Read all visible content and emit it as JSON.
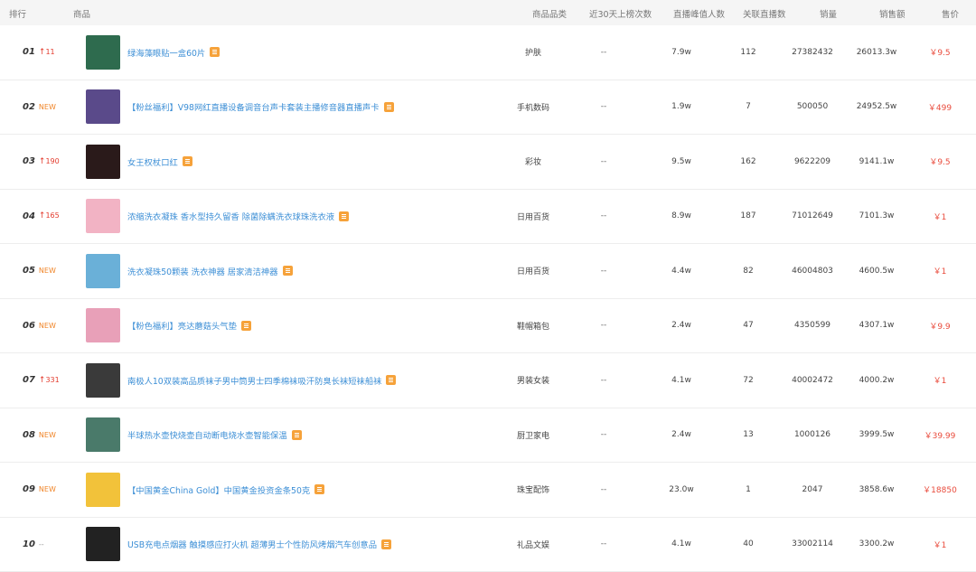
{
  "headers": {
    "rank": "排行",
    "product": "商品",
    "category": "商品品类",
    "times": "近30天上榜次数",
    "peak": "直播峰值人数",
    "live": "关联直播数",
    "sales": "销量",
    "amount": "销售额",
    "price": "售价"
  },
  "rows": [
    {
      "rank": "01",
      "change": "11",
      "change_type": "up",
      "name": "绿海藻眼贴一盒60片",
      "category": "护肤",
      "times": "--",
      "peak": "7.9w",
      "live": "112",
      "sales": "27382432",
      "amount": "26013.3w",
      "price": "￥9.5",
      "thumb_color": "#2e6b4e"
    },
    {
      "rank": "02",
      "change": "NEW",
      "change_type": "new",
      "name": "【粉丝福利】V98网红直播设备调音台声卡套装主播修音器直播声卡",
      "category": "手机数码",
      "times": "--",
      "peak": "1.9w",
      "live": "7",
      "sales": "500050",
      "amount": "24952.5w",
      "price": "￥499",
      "thumb_color": "#5a4a8a"
    },
    {
      "rank": "03",
      "change": "190",
      "change_type": "up",
      "name": "女王权杖口红",
      "category": "彩妆",
      "times": "--",
      "peak": "9.5w",
      "live": "162",
      "sales": "9622209",
      "amount": "9141.1w",
      "price": "￥9.5",
      "thumb_color": "#2a1a1a"
    },
    {
      "rank": "04",
      "change": "165",
      "change_type": "up",
      "name": "浓缩洗衣凝珠 香水型持久留香 除菌除螨洗衣球珠洗衣液",
      "category": "日用百货",
      "times": "--",
      "peak": "8.9w",
      "live": "187",
      "sales": "71012649",
      "amount": "7101.3w",
      "price": "￥1",
      "thumb_color": "#f2b3c4"
    },
    {
      "rank": "05",
      "change": "NEW",
      "change_type": "new",
      "name": "洗衣凝珠50颗装 洗衣神器 居家清洁神器",
      "category": "日用百货",
      "times": "--",
      "peak": "4.4w",
      "live": "82",
      "sales": "46004803",
      "amount": "4600.5w",
      "price": "￥1",
      "thumb_color": "#6ab0d8"
    },
    {
      "rank": "06",
      "change": "NEW",
      "change_type": "new",
      "name": "【粉色福利】亮达蘑菇头气垫",
      "category": "鞋帽箱包",
      "times": "--",
      "peak": "2.4w",
      "live": "47",
      "sales": "4350599",
      "amount": "4307.1w",
      "price": "￥9.9",
      "thumb_color": "#e8a0b8"
    },
    {
      "rank": "07",
      "change": "331",
      "change_type": "up",
      "name": "南极人10双装高品质袜子男中筒男士四季棉袜吸汗防臭长袜短袜船袜",
      "category": "男装女装",
      "times": "--",
      "peak": "4.1w",
      "live": "72",
      "sales": "40002472",
      "amount": "4000.2w",
      "price": "￥1",
      "thumb_color": "#3a3a3a"
    },
    {
      "rank": "08",
      "change": "NEW",
      "change_type": "new",
      "name": "半球热水壶快烧壶自动断电烧水壶智能保温",
      "category": "厨卫家电",
      "times": "--",
      "peak": "2.4w",
      "live": "13",
      "sales": "1000126",
      "amount": "3999.5w",
      "price": "￥39.99",
      "thumb_color": "#4a7a6a"
    },
    {
      "rank": "09",
      "change": "NEW",
      "change_type": "new",
      "name": "【中国黄金China Gold】中国黄金投资金条50克",
      "category": "珠宝配饰",
      "times": "--",
      "peak": "23.0w",
      "live": "1",
      "sales": "2047",
      "amount": "3858.6w",
      "price": "￥18850",
      "thumb_color": "#f2c23a"
    },
    {
      "rank": "10",
      "change": "--",
      "change_type": "same",
      "name": "USB充电点烟器 触摸感应打火机 超薄男士个性防风烤烟汽车创意品",
      "category": "礼品文娱",
      "times": "--",
      "peak": "4.1w",
      "live": "40",
      "sales": "33002114",
      "amount": "3300.2w",
      "price": "￥1",
      "thumb_color": "#222222"
    }
  ]
}
